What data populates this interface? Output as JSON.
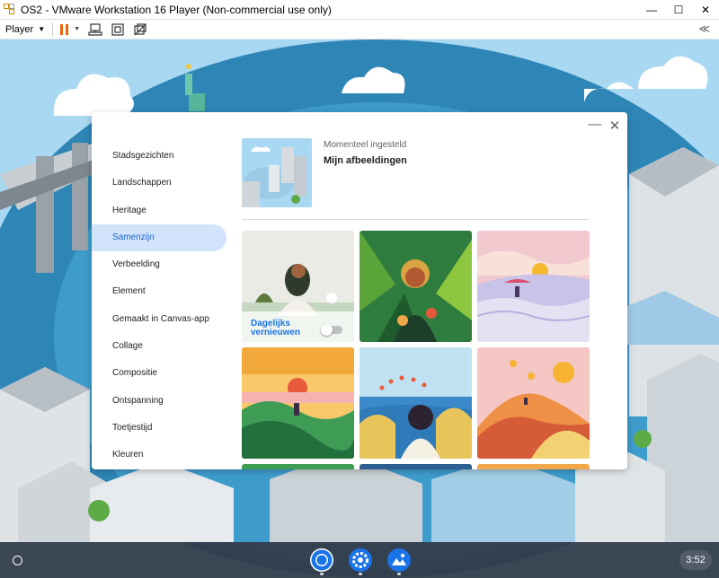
{
  "window": {
    "title": "OS2 - VMware Workstation 16 Player (Non-commercial use only)",
    "minimize_glyph": "—",
    "maximize_glyph": "☐",
    "close_glyph": "✕"
  },
  "toolbar": {
    "player_label": "Player",
    "player_caret": "▼",
    "pause_caret": "▼",
    "collapse_glyph": "≪"
  },
  "wallpaper_dialog": {
    "minimize_glyph": "—",
    "close_glyph": "✕",
    "categories": [
      {
        "label": "Stadsgezichten",
        "active": false
      },
      {
        "label": "Landschappen",
        "active": false
      },
      {
        "label": "Heritage",
        "active": false
      },
      {
        "label": "Samenzijn",
        "active": true
      },
      {
        "label": "Verbeelding",
        "active": false
      },
      {
        "label": "Element",
        "active": false
      },
      {
        "label": "Gemaakt in Canvas-app",
        "active": false
      },
      {
        "label": "Collage",
        "active": false
      },
      {
        "label": "Compositie",
        "active": false
      },
      {
        "label": "Ontspanning",
        "active": false
      },
      {
        "label": "Toetjestijd",
        "active": false
      },
      {
        "label": "Kleuren",
        "active": false
      }
    ],
    "current": {
      "label": "Momenteel ingesteld",
      "name": "Mijn afbeeldingen"
    },
    "daily_refresh": {
      "label": "Dagelijks vernieuwen",
      "enabled": false
    }
  },
  "shelf": {
    "apps": [
      "chrome-icon",
      "settings-icon",
      "wallpaper-icon"
    ],
    "clock": "3:52"
  },
  "colors": {
    "accent": "#1a73e8",
    "active_category_bg": "#d2e3fc",
    "shelf_bg": "#323a46",
    "pause_orange": "#e8660b"
  }
}
